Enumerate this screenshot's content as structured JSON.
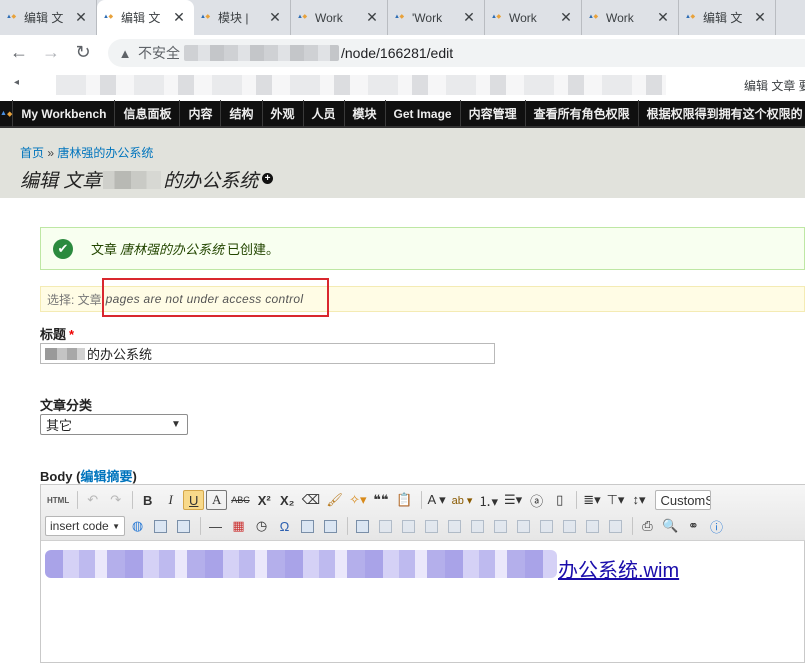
{
  "browser": {
    "tabs": [
      {
        "label": "编辑 文",
        "active": false
      },
      {
        "label": "编辑 文",
        "active": true
      },
      {
        "label": "模块 |",
        "active": false
      },
      {
        "label": "Work",
        "active": false
      },
      {
        "label": "'Work",
        "active": false
      },
      {
        "label": "Work",
        "active": false
      },
      {
        "label": "Work",
        "active": false
      },
      {
        "label": "编辑 文",
        "active": false
      }
    ],
    "insecure_label": "不安全",
    "url_visible": "/node/166281/edit",
    "bookmark_visible": "编辑 文章 要"
  },
  "admin_menu": {
    "items": [
      "My Workbench",
      "信息面板",
      "内容",
      "结构",
      "外观",
      "人员",
      "模块",
      "Get Image",
      "内容管理",
      "查看所有角色权限",
      "根据权限得到拥有这个权限的"
    ]
  },
  "header": {
    "breadcrumb_home": "首页",
    "breadcrumb_sep": "»",
    "breadcrumb_current": "唐林强的办公系统",
    "title_prefix": "编辑 文章",
    "title_suffix": "的办公系统"
  },
  "messages": {
    "status_prefix": "文章",
    "status_link": "唐林强的办公系统",
    "status_suffix": "已创建。",
    "warn_label": "选择: 文章",
    "warn_desc": "pages are not under access control"
  },
  "form": {
    "title_label": "标题",
    "required_mark": "*",
    "title_value_visible": "的办公系统",
    "category_label": "文章分类",
    "category_value": "其它",
    "body_label": "Body",
    "body_paren_open": "(",
    "body_link": "编辑摘要",
    "body_paren_close": ")"
  },
  "editor": {
    "row1": [
      "HTML",
      "undo",
      "redo",
      "B",
      "I",
      "U",
      "A",
      "ABC",
      "X²",
      "X₂",
      "eraser",
      "brush",
      "magic",
      "❝❝",
      "paste",
      "A ▾",
      "ab ▾",
      "ol",
      "ul",
      "a",
      "page",
      "align",
      "valign",
      "spacing"
    ],
    "format_combo": "CustomSt",
    "insert_combo": "insert code",
    "row2": [
      "globe",
      "media",
      "media2",
      "hr",
      "calendar",
      "clock",
      "Ω",
      "img",
      "img2",
      "table",
      "tbl1",
      "tbl2",
      "tbl3",
      "tbl4",
      "tbl5",
      "tbl6",
      "tbl7",
      "tbl8",
      "tbl9",
      "tbl10",
      "print",
      "search",
      "binoculars",
      "help"
    ],
    "content_link": "办公系统.wim"
  }
}
